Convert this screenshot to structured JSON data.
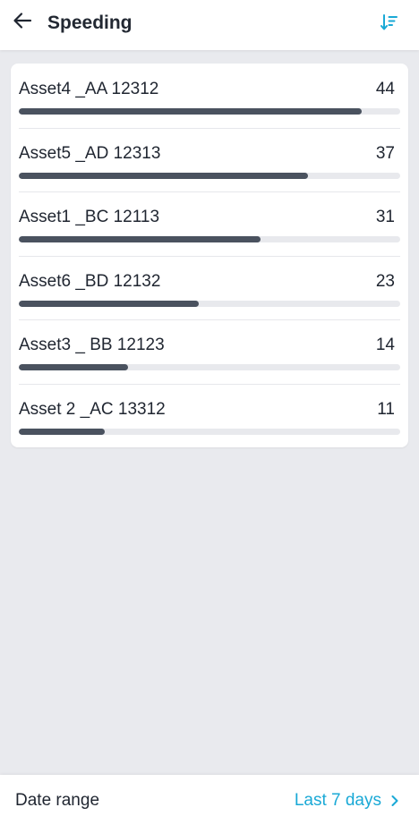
{
  "header": {
    "title": "Speeding",
    "back_icon": "arrow-left-icon",
    "sort_icon": "sort-descending-icon"
  },
  "list": {
    "items": [
      {
        "label": "Asset4 _AA 12312",
        "value": "44",
        "progress_pct": 90
      },
      {
        "label": "Asset5 _AD 12313",
        "value": "37",
        "progress_pct": 75.8
      },
      {
        "label": "Asset1 _BC 12113",
        "value": "31",
        "progress_pct": 63.4
      },
      {
        "label": "Asset6 _BD 12132",
        "value": "23",
        "progress_pct": 47.2
      },
      {
        "label": "Asset3 _ BB 12123",
        "value": "14",
        "progress_pct": 28.6
      },
      {
        "label": "Asset 2 _AC 13312",
        "value": "11",
        "progress_pct": 22.5
      }
    ]
  },
  "footer": {
    "label": "Date range",
    "value": "Last 7 days",
    "chevron_icon": "chevron-right-icon"
  },
  "colors": {
    "accent": "#1aa9d6",
    "bar_fill": "#4a525f",
    "bar_track": "#e8e9ed",
    "background": "#e9eaee"
  }
}
